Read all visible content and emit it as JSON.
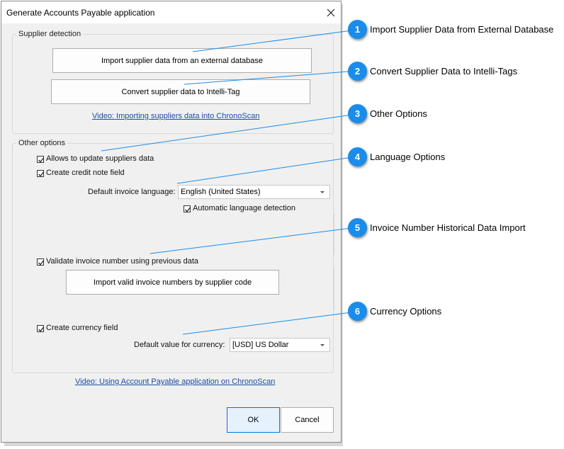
{
  "dialog": {
    "title": "Generate Accounts Payable application",
    "close_glyph": "✕"
  },
  "supplier_detection": {
    "legend": "Supplier detection",
    "import_button": "Import supplier data from an external database",
    "convert_button": "Convert supplier data to Intelli-Tag",
    "video_link": "Video: Importing suppliers data into ChronoScan"
  },
  "other_options": {
    "legend": "Other options",
    "allow_update": {
      "label": "Allows to update suppliers data",
      "checked": true
    },
    "credit_note": {
      "label": "Create credit note field",
      "checked": true
    },
    "language_label": "Default invoice language:",
    "language_value": "English (United States)",
    "auto_language": {
      "label": "Automatic language detection",
      "checked": true
    },
    "validate_invoice": {
      "label": "Validate invoice number using previous data",
      "checked": true
    },
    "import_invoice_button": "Import valid invoice numbers by supplier code",
    "currency_field": {
      "label": "Create currency field",
      "checked": true
    },
    "currency_label": "Default value for currency:",
    "currency_value": "[USD] US Dollar"
  },
  "footer": {
    "video_link": "Video: Using Account Payable application on ChronoScan",
    "ok_button": "OK",
    "cancel_button": "Cancel"
  },
  "callouts": [
    {
      "number": "1",
      "text": "Import Supplier Data from External Database"
    },
    {
      "number": "2",
      "text": "Convert Supplier Data to Intelli-Tags"
    },
    {
      "number": "3",
      "text": "Other Options"
    },
    {
      "number": "4",
      "text": "Language Options"
    },
    {
      "number": "5",
      "text": "Invoice Number Historical Data Import"
    },
    {
      "number": "6",
      "text": "Currency Options"
    }
  ],
  "colors": {
    "badge": "#1a8ceb",
    "link": "#1a4ea0",
    "ok_border": "#0078d7"
  }
}
